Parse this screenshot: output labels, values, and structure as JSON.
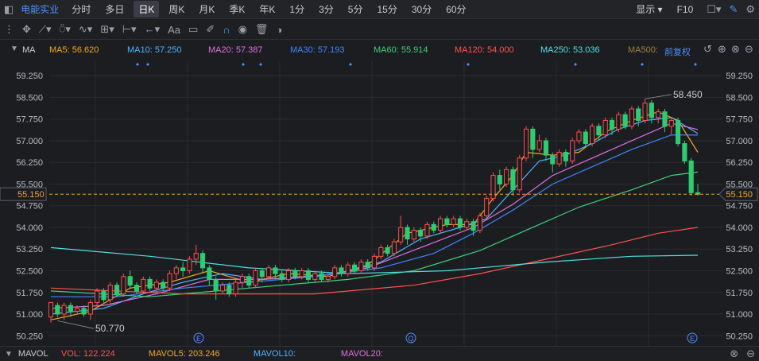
{
  "topbar": {
    "stock_name": "电能实业",
    "tabs": [
      "分时",
      "多日",
      "日K",
      "周K",
      "月K",
      "季K",
      "年K",
      "1分",
      "3分",
      "5分",
      "15分",
      "30分",
      "60分"
    ],
    "active_tab": "日K",
    "display_label": "显示",
    "f10_label": "F10"
  },
  "ma_bar": {
    "label": "MA",
    "items": [
      {
        "text": "MA5: 56.620",
        "color": "#f5a623"
      },
      {
        "text": "MA10: 57.250",
        "color": "#4fb3ff"
      },
      {
        "text": "MA20: 57.387",
        "color": "#e070e0"
      },
      {
        "text": "MA30: 57.193",
        "color": "#3f86ff"
      },
      {
        "text": "MA60: 55.914",
        "color": "#3dd07c"
      },
      {
        "text": "MA120: 54.000",
        "color": "#ff5050"
      },
      {
        "text": "MA250: 53.036",
        "color": "#4de0e0"
      },
      {
        "text": "MA500:",
        "color": "#a08040"
      }
    ],
    "adjust_label": "前复权"
  },
  "vol_bar": {
    "label": "MAVOL",
    "vol": "VOL: 122.224",
    "mavol5": "MAVOL5: 203.246",
    "mavol10": "MAVOL10:",
    "mavol20": "MAVOL20:"
  },
  "chart_data": {
    "type": "candlestick",
    "ylim": [
      49.9,
      59.75
    ],
    "yticks": [
      "59.250",
      "58.500",
      "57.750",
      "57.000",
      "56.250",
      "55.500",
      "54.750",
      "54.000",
      "53.250",
      "52.500",
      "51.750",
      "51.000",
      "50.250"
    ],
    "current_price": "55.150",
    "annotations": {
      "high": "58.450",
      "low": "50.770"
    },
    "event_markers": [
      "E",
      "Q",
      "E"
    ],
    "colors": {
      "up": "#ff4d4d",
      "down": "#2ecc71",
      "grid": "#2a2c31",
      "current": "#f0a040"
    },
    "candles": [
      [
        50.9,
        51.4,
        50.7,
        51.3
      ],
      [
        51.3,
        51.0,
        50.9,
        51.4
      ],
      [
        51.0,
        51.3,
        50.8,
        51.4
      ],
      [
        51.3,
        51.1,
        50.9,
        51.4
      ],
      [
        51.1,
        51.2,
        51.0,
        51.3
      ],
      [
        51.2,
        51.0,
        50.9,
        51.3
      ],
      [
        51.0,
        51.4,
        50.8,
        51.5
      ],
      [
        51.4,
        51.8,
        51.2,
        51.9
      ],
      [
        51.8,
        51.5,
        51.4,
        51.9
      ],
      [
        51.5,
        52.0,
        51.4,
        52.1
      ],
      [
        52.0,
        51.7,
        51.6,
        52.1
      ],
      [
        51.7,
        52.3,
        51.6,
        52.4
      ],
      [
        52.3,
        52.0,
        51.9,
        52.5
      ],
      [
        52.0,
        51.8,
        51.7,
        52.1
      ],
      [
        51.8,
        52.2,
        51.7,
        52.3
      ],
      [
        52.2,
        51.9,
        51.8,
        52.3
      ],
      [
        51.9,
        52.1,
        51.8,
        52.2
      ],
      [
        52.1,
        51.9,
        51.8,
        52.2
      ],
      [
        51.9,
        52.4,
        51.8,
        52.5
      ],
      [
        52.4,
        52.6,
        52.2,
        52.7
      ],
      [
        52.6,
        52.5,
        52.3,
        52.8
      ],
      [
        52.5,
        52.9,
        52.4,
        53.0
      ],
      [
        52.9,
        53.1,
        52.7,
        53.4
      ],
      [
        53.1,
        52.6,
        52.4,
        53.2
      ],
      [
        52.6,
        52.2,
        52.0,
        52.7
      ],
      [
        52.2,
        51.8,
        51.5,
        52.3
      ],
      [
        51.8,
        52.0,
        51.7,
        52.1
      ],
      [
        52.0,
        51.7,
        51.6,
        52.1
      ],
      [
        51.7,
        52.1,
        51.6,
        52.2
      ],
      [
        52.1,
        52.3,
        51.9,
        52.4
      ],
      [
        52.3,
        52.0,
        51.9,
        52.4
      ],
      [
        52.0,
        52.5,
        51.9,
        52.6
      ],
      [
        52.5,
        52.3,
        52.1,
        52.6
      ],
      [
        52.3,
        52.6,
        52.2,
        52.7
      ],
      [
        52.6,
        52.4,
        52.2,
        52.7
      ],
      [
        52.4,
        52.2,
        52.1,
        52.5
      ],
      [
        52.2,
        52.5,
        52.1,
        52.6
      ],
      [
        52.5,
        52.3,
        52.2,
        52.6
      ],
      [
        52.3,
        52.5,
        52.2,
        52.6
      ],
      [
        52.5,
        52.2,
        52.1,
        52.6
      ],
      [
        52.2,
        52.4,
        52.1,
        52.5
      ],
      [
        52.4,
        52.2,
        52.1,
        52.5
      ],
      [
        52.2,
        52.3,
        52.1,
        52.4
      ],
      [
        52.3,
        52.6,
        52.2,
        52.7
      ],
      [
        52.6,
        52.4,
        52.3,
        52.7
      ],
      [
        52.4,
        52.7,
        52.3,
        52.8
      ],
      [
        52.7,
        52.5,
        52.4,
        52.8
      ],
      [
        52.5,
        52.8,
        52.4,
        52.9
      ],
      [
        52.8,
        52.6,
        52.5,
        52.9
      ],
      [
        52.6,
        53.0,
        52.5,
        53.1
      ],
      [
        53.0,
        53.3,
        52.9,
        53.4
      ],
      [
        53.3,
        53.1,
        53.0,
        53.4
      ],
      [
        53.1,
        53.5,
        53.0,
        53.6
      ],
      [
        53.5,
        54.0,
        53.4,
        54.4
      ],
      [
        54.0,
        53.6,
        53.4,
        54.1
      ],
      [
        53.6,
        53.9,
        53.5,
        54.0
      ],
      [
        53.9,
        53.7,
        53.5,
        54.0
      ],
      [
        53.7,
        54.1,
        53.6,
        54.2
      ],
      [
        54.1,
        53.9,
        53.8,
        54.2
      ],
      [
        53.9,
        54.3,
        53.8,
        54.4
      ],
      [
        54.3,
        54.1,
        54.0,
        54.4
      ],
      [
        54.1,
        54.3,
        54.0,
        54.4
      ],
      [
        54.3,
        54.0,
        53.9,
        54.4
      ],
      [
        54.0,
        54.2,
        53.9,
        54.3
      ],
      [
        54.2,
        53.9,
        53.7,
        54.3
      ],
      [
        53.9,
        54.4,
        53.8,
        54.5
      ],
      [
        54.4,
        55.0,
        54.3,
        55.1
      ],
      [
        55.0,
        55.8,
        54.9,
        55.9
      ],
      [
        55.8,
        55.5,
        55.3,
        56.0
      ],
      [
        55.5,
        56.0,
        55.4,
        56.1
      ],
      [
        56.0,
        55.3,
        55.1,
        56.1
      ],
      [
        55.3,
        56.4,
        55.2,
        56.5
      ],
      [
        56.4,
        57.4,
        56.3,
        57.5
      ],
      [
        57.4,
        56.7,
        56.4,
        57.5
      ],
      [
        56.7,
        57.0,
        56.6,
        57.2
      ],
      [
        57.0,
        56.5,
        56.3,
        57.1
      ],
      [
        56.5,
        56.2,
        55.9,
        56.6
      ],
      [
        56.2,
        56.6,
        56.1,
        56.7
      ],
      [
        56.6,
        56.3,
        56.1,
        56.7
      ],
      [
        56.3,
        57.0,
        56.2,
        57.1
      ],
      [
        57.0,
        57.3,
        56.9,
        57.4
      ],
      [
        57.3,
        56.9,
        56.8,
        57.4
      ],
      [
        56.9,
        57.5,
        56.8,
        57.6
      ],
      [
        57.5,
        57.2,
        57.0,
        57.6
      ],
      [
        57.2,
        57.7,
        57.1,
        57.8
      ],
      [
        57.7,
        57.4,
        57.2,
        57.8
      ],
      [
        57.4,
        57.9,
        57.3,
        58.0
      ],
      [
        57.9,
        57.5,
        57.4,
        58.0
      ],
      [
        57.5,
        58.1,
        57.4,
        58.2
      ],
      [
        58.1,
        57.7,
        57.5,
        58.2
      ],
      [
        57.7,
        58.3,
        57.6,
        58.45
      ],
      [
        58.3,
        57.8,
        57.6,
        58.4
      ],
      [
        57.8,
        58.0,
        57.6,
        58.1
      ],
      [
        58.0,
        57.5,
        57.3,
        58.1
      ],
      [
        57.5,
        57.7,
        57.2,
        57.8
      ],
      [
        57.7,
        56.9,
        56.8,
        57.8
      ],
      [
        56.9,
        56.3,
        56.2,
        57.0
      ],
      [
        56.3,
        55.2,
        55.1,
        56.4
      ],
      [
        55.2,
        55.15,
        55.1,
        55.5
      ]
    ],
    "series": [
      {
        "name": "MA5",
        "color": "#f5a623",
        "values": [
          [
            0,
            50.8
          ],
          [
            6,
            51.1
          ],
          [
            12,
            51.9
          ],
          [
            18,
            52.1
          ],
          [
            24,
            52.5
          ],
          [
            30,
            52.1
          ],
          [
            36,
            52.4
          ],
          [
            42,
            52.3
          ],
          [
            48,
            52.7
          ],
          [
            54,
            53.8
          ],
          [
            60,
            54.1
          ],
          [
            64,
            54.1
          ],
          [
            67,
            55.0
          ],
          [
            70,
            55.8
          ],
          [
            72,
            56.6
          ],
          [
            76,
            56.5
          ],
          [
            80,
            56.6
          ],
          [
            84,
            57.3
          ],
          [
            88,
            57.7
          ],
          [
            92,
            58.0
          ],
          [
            95,
            57.7
          ],
          [
            98,
            56.6
          ]
        ]
      },
      {
        "name": "MA10",
        "color": "#4fb3ff",
        "values": [
          [
            0,
            51.0
          ],
          [
            8,
            51.2
          ],
          [
            14,
            51.7
          ],
          [
            20,
            52.1
          ],
          [
            26,
            52.4
          ],
          [
            32,
            52.2
          ],
          [
            38,
            52.3
          ],
          [
            44,
            52.4
          ],
          [
            50,
            52.8
          ],
          [
            56,
            53.6
          ],
          [
            62,
            54.0
          ],
          [
            66,
            54.3
          ],
          [
            70,
            55.3
          ],
          [
            74,
            56.3
          ],
          [
            78,
            56.5
          ],
          [
            82,
            56.9
          ],
          [
            86,
            57.4
          ],
          [
            90,
            57.7
          ],
          [
            94,
            57.8
          ],
          [
            98,
            57.25
          ]
        ]
      },
      {
        "name": "MA20",
        "color": "#e070e0",
        "values": [
          [
            0,
            51.2
          ],
          [
            8,
            51.3
          ],
          [
            16,
            51.7
          ],
          [
            24,
            52.2
          ],
          [
            32,
            52.2
          ],
          [
            40,
            52.3
          ],
          [
            48,
            52.6
          ],
          [
            56,
            53.3
          ],
          [
            64,
            54.0
          ],
          [
            70,
            54.8
          ],
          [
            76,
            55.8
          ],
          [
            82,
            56.4
          ],
          [
            88,
            57.0
          ],
          [
            94,
            57.6
          ],
          [
            98,
            57.387
          ]
        ]
      },
      {
        "name": "MA30",
        "color": "#3f86ff",
        "values": [
          [
            0,
            51.6
          ],
          [
            10,
            51.6
          ],
          [
            20,
            51.9
          ],
          [
            30,
            52.1
          ],
          [
            40,
            52.3
          ],
          [
            50,
            52.6
          ],
          [
            58,
            53.1
          ],
          [
            64,
            53.8
          ],
          [
            70,
            54.6
          ],
          [
            76,
            55.5
          ],
          [
            82,
            56.1
          ],
          [
            88,
            56.7
          ],
          [
            94,
            57.2
          ],
          [
            98,
            57.193
          ]
        ]
      },
      {
        "name": "MA60",
        "color": "#3dd07c",
        "values": [
          [
            0,
            51.8
          ],
          [
            15,
            51.6
          ],
          [
            30,
            51.9
          ],
          [
            45,
            52.2
          ],
          [
            55,
            52.5
          ],
          [
            65,
            53.2
          ],
          [
            72,
            53.9
          ],
          [
            80,
            54.7
          ],
          [
            88,
            55.3
          ],
          [
            94,
            55.8
          ],
          [
            98,
            55.914
          ]
        ]
      },
      {
        "name": "MA120",
        "color": "#ff5050",
        "values": [
          [
            0,
            51.9
          ],
          [
            20,
            51.7
          ],
          [
            40,
            51.7
          ],
          [
            55,
            52.0
          ],
          [
            65,
            52.4
          ],
          [
            75,
            52.9
          ],
          [
            85,
            53.4
          ],
          [
            92,
            53.8
          ],
          [
            98,
            54.0
          ]
        ]
      },
      {
        "name": "MA250",
        "color": "#4de0e0",
        "values": [
          [
            0,
            53.3
          ],
          [
            15,
            53.0
          ],
          [
            30,
            52.6
          ],
          [
            45,
            52.4
          ],
          [
            60,
            52.5
          ],
          [
            75,
            52.8
          ],
          [
            88,
            53.0
          ],
          [
            98,
            53.036
          ]
        ]
      }
    ]
  }
}
